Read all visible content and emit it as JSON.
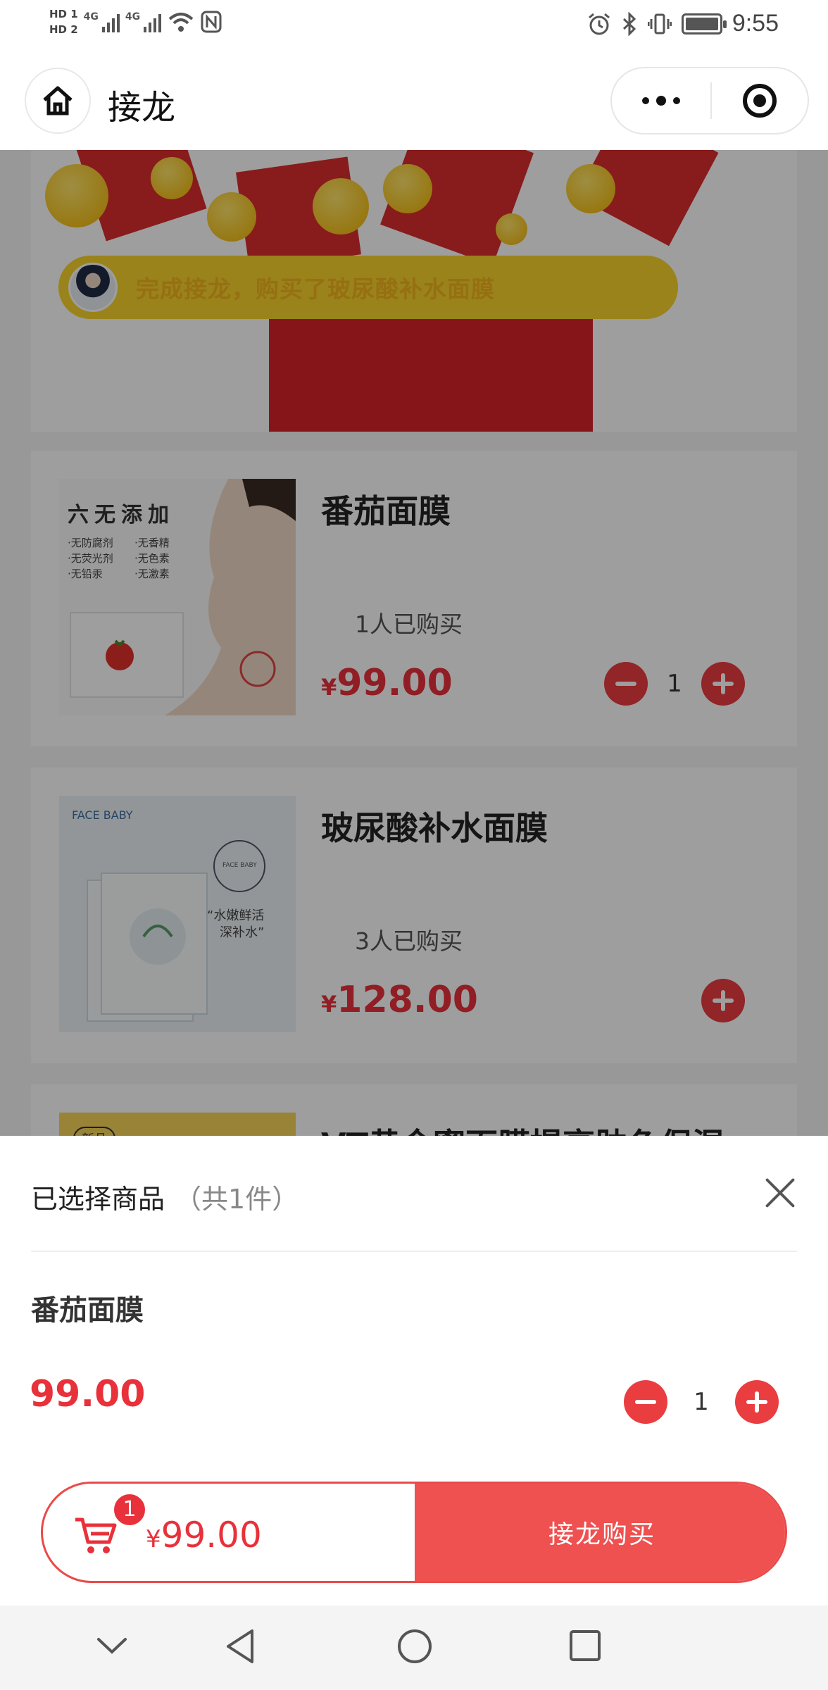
{
  "status_bar": {
    "sim1": "HD 1",
    "sim2": "HD 2",
    "net1": "4G",
    "net2": "4G",
    "time": "9:55",
    "icons": [
      "signal-icon",
      "wifi-icon",
      "nfc-icon",
      "alarm-icon",
      "bluetooth-icon",
      "vibrate-icon",
      "battery-icon"
    ]
  },
  "header": {
    "title": "接龙",
    "home_icon": "home-icon",
    "more_icon": "more-icon",
    "close_icon": "target-icon"
  },
  "banner": {
    "notice": "完成接龙，购买了玻尿酸补水面膜"
  },
  "products": [
    {
      "name": "番茄面膜",
      "sold": "1人已购买",
      "currency": "¥",
      "price": "99.00",
      "quantity": "1",
      "image_text": {
        "title": "六无添加",
        "items": [
          "·无防腐剂",
          "·无香精",
          "·无荧光剂",
          "·无色素",
          "·无铅汞",
          "·无激素"
        ]
      }
    },
    {
      "name": "玻尿酸补水面膜",
      "sold": "3人已购买",
      "currency": "¥",
      "price": "128.00",
      "image_text": {
        "brand": "FACE BABY",
        "seal": "FACE BABY",
        "slogan1": "“水嫩鲜活",
        "slogan2": "深补水”"
      }
    },
    {
      "name": "VT黄金蜜面膜提亮肤色保湿",
      "image_text": {
        "tag": "新品"
      }
    }
  ],
  "sheet": {
    "title": "已选择商品",
    "count": "（共1件）",
    "item_name": "番茄面膜",
    "item_price": "99.00",
    "item_qty": "1"
  },
  "buy_bar": {
    "badge": "1",
    "currency": "¥",
    "total": "99.00",
    "button": "接龙购买"
  },
  "nav_bar": {
    "icons": [
      "collapse-icon",
      "back-icon",
      "home-circle-icon",
      "recents-icon"
    ]
  },
  "colors": {
    "accent_red": "#e8313a",
    "button_red": "#ef5050",
    "notice_yellow": "#f7d42a"
  }
}
